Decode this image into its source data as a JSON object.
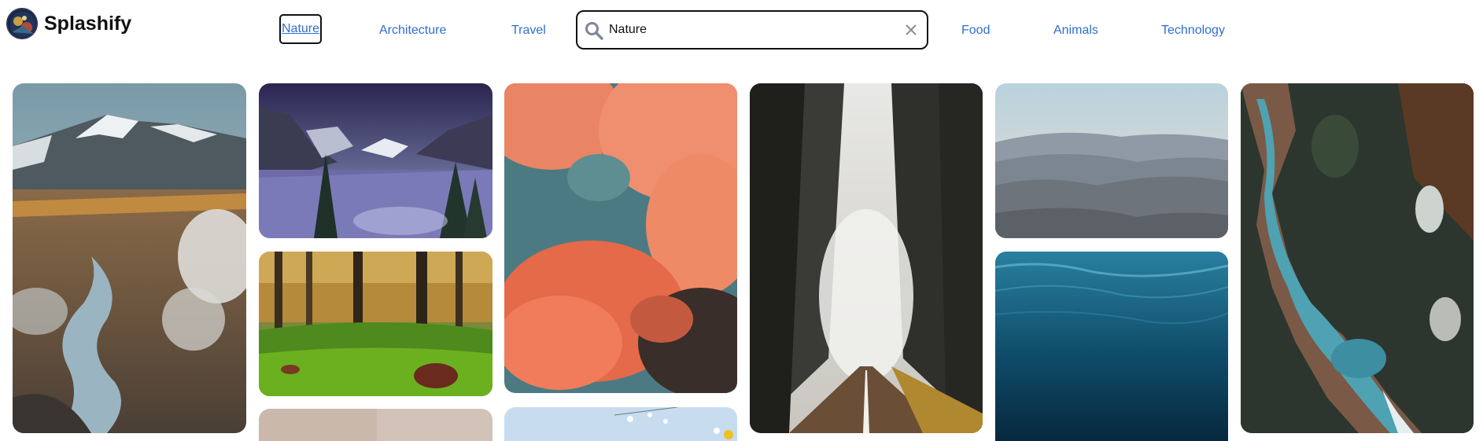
{
  "brand": {
    "name": "Splashify",
    "avatar": "logo-avatar"
  },
  "nav": {
    "items": [
      {
        "label": "Nature",
        "active": true
      },
      {
        "label": "Architecture"
      },
      {
        "label": "Travel"
      },
      {
        "label": "Food"
      },
      {
        "label": "Animals"
      },
      {
        "label": "Technology"
      }
    ]
  },
  "search": {
    "value": "Nature",
    "icon": "search-icon",
    "clear_icon": "close-icon"
  },
  "photos": [
    {
      "subject": "snowy mountain valley with hot springs steam"
    },
    {
      "subject": "winter forest valley with granite cliffs"
    },
    {
      "subject": "orange-pink clouds against teal sky"
    },
    {
      "subject": "misty forest road"
    },
    {
      "subject": "layered hazy mountain ridges"
    },
    {
      "subject": "aerial river gorge in forest"
    },
    {
      "subject": "green mossy forest floor in autumn"
    },
    {
      "subject": "deep blue underwater ocean"
    },
    {
      "subject": "pale beige blurred photo"
    },
    {
      "subject": "sky with white and yellow flowers"
    }
  ],
  "colors": {
    "link": "#2f6fd3",
    "active_border": "#111111"
  }
}
